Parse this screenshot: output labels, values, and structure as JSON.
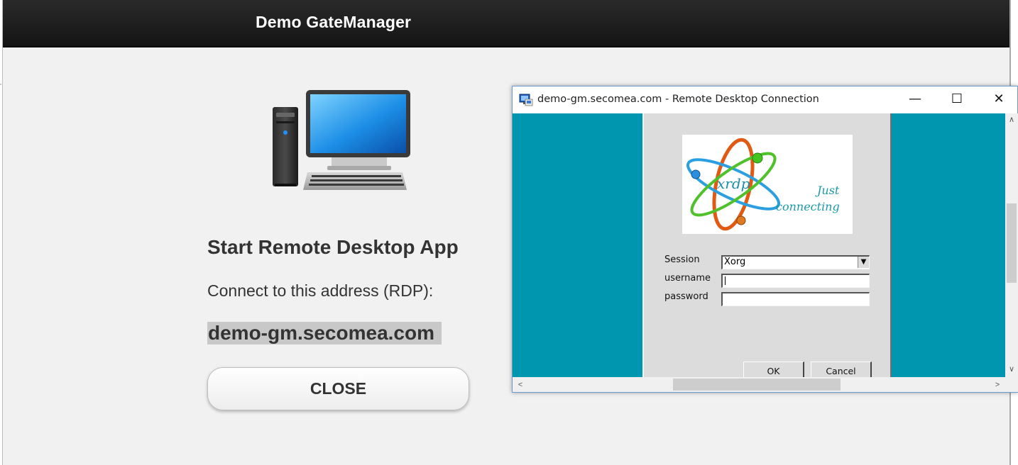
{
  "page": {
    "header_title": "Demo GateManager",
    "heading": "Start Remote Desktop App",
    "connect_text": "Connect to this address (RDP):",
    "address": "demo-gm.secomea.com",
    "close_label": "CLOSE",
    "computer_icon": "desktop-computer-icon"
  },
  "rdp_window": {
    "title": "demo-gm.secomea.com - Remote Desktop Connection",
    "app_icon": "remote-desktop-icon",
    "controls": {
      "minimize": "—",
      "maximize": "☐",
      "close": "✕"
    },
    "login": {
      "logo_text": "xrdp",
      "tagline_line1": "Just",
      "tagline_line2": "connecting",
      "session_label": "Session",
      "session_value": "Xorg",
      "username_label": "username",
      "username_value": "",
      "password_label": "password",
      "password_value": "",
      "ok_label": "OK",
      "cancel_label": "Cancel"
    },
    "scroll_arrows": {
      "up": "∧",
      "down": "∨",
      "left": "<",
      "right": ">"
    },
    "colors": {
      "desktop_bg": "#0096b0",
      "panel_bg": "#dcdcdc"
    }
  }
}
